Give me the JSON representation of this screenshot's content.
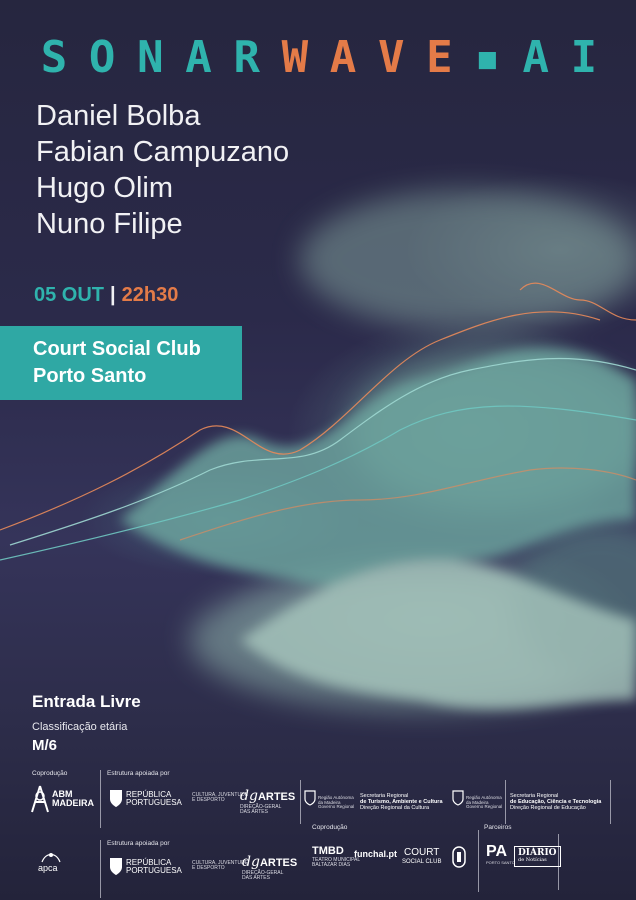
{
  "title": {
    "part1": [
      "S",
      "O",
      "N",
      "A",
      "R"
    ],
    "part2": [
      "W",
      "A",
      "V",
      "E"
    ],
    "dot": "▪",
    "part3": [
      "A",
      "I"
    ]
  },
  "artists": [
    "Daniel Bolba",
    "Fabian Campuzano",
    "Hugo Olim",
    "Nuno Filipe"
  ],
  "date": {
    "day": "05 OUT",
    "separator": "|",
    "time": "22h30"
  },
  "venue": {
    "line1": "Court Social Club",
    "line2": "Porto Santo"
  },
  "entry": "Entrada Livre",
  "rating": {
    "label": "Classificação etária",
    "value": "M/6"
  },
  "footer": {
    "coproducao1": "Coprodução",
    "estrutura1": "Estrutura apoiada por",
    "estrutura2": "Estrutura apoiada por",
    "coproducao2": "Coprodução",
    "parceiros": "Parceiros",
    "abm": {
      "line1": "ABM",
      "line2": "MADEIRA"
    },
    "apca": "apca",
    "republica1": {
      "line1": "REPÚBLICA",
      "line2": "PORTUGUESA"
    },
    "republica2": {
      "line1": "REPÚBLICA",
      "line2": "PORTUGUESA"
    },
    "cultura1": {
      "line1": "CULTURA, JUVENTUDE",
      "line2": "E DESPORTO"
    },
    "cultura2": {
      "line1": "CULTURA, JUVENTUDE",
      "line2": "E DESPORTO"
    },
    "dgartes1": {
      "mark": "dg",
      "word": "ARTES",
      "sub1": "DIREÇÃO-GERAL",
      "sub2": "DAS ARTES"
    },
    "dgartes2": {
      "mark": "dg",
      "word": "ARTES",
      "sub1": "DIREÇÃO-GERAL",
      "sub2": "DAS ARTES"
    },
    "madeira1": {
      "line1": "Região Autónoma",
      "line2": "da Madeira",
      "line3": "Governo Regional"
    },
    "sec1": {
      "line1": "Secretaria Regional",
      "line2": "de Turismo, Ambiente e Cultura",
      "line3": "Direção Regional da Cultura"
    },
    "madeira2": {
      "line1": "Região Autónoma",
      "line2": "da Madeira",
      "line3": "Governo Regional"
    },
    "sec2": {
      "line1": "Secretaria Regional",
      "line2": "de Educação, Ciência e Tecnologia",
      "line3": "Direção Regional de Educação"
    },
    "tmbd": {
      "mark": "TMBD",
      "line1": "TEATRO MUNICIPAL",
      "line2": "BALTAZAR DIAS"
    },
    "funchal": "funchal.pt",
    "court": {
      "line1": "COURT",
      "line2": "SOCIAL CLUB"
    },
    "pa": {
      "mark": "PA",
      "sub": "PORTO SANTO"
    },
    "diario": {
      "line1": "DIÁRIO",
      "line2": "de Notícias"
    }
  },
  "colors": {
    "teal": "#2fb3ad",
    "orange": "#e47b48",
    "venue_bg": "#2fa8a4",
    "background": "#2b2a4a"
  }
}
